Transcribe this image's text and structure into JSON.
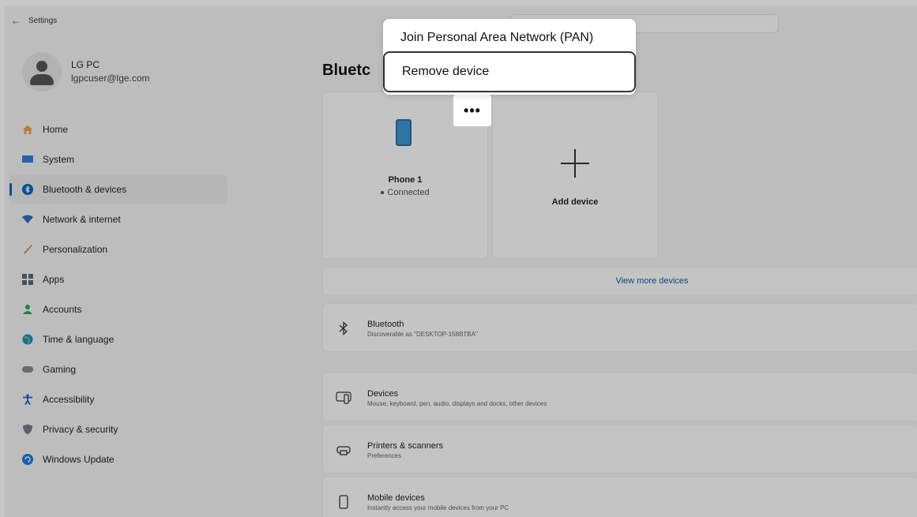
{
  "window": {
    "title": "Settings",
    "back_icon": "←"
  },
  "profile": {
    "name": "LG PC",
    "email": "lgpcuser@lge.com"
  },
  "sidebar": {
    "items": [
      {
        "label": "Home",
        "icon": "home-icon",
        "color": "#e8a33c"
      },
      {
        "label": "System",
        "icon": "system-icon",
        "color": "#2f7fd8"
      },
      {
        "label": "Bluetooth & devices",
        "icon": "bluetooth-icon",
        "color": "#0067c0",
        "active": true
      },
      {
        "label": "Network & internet",
        "icon": "wifi-icon",
        "color": "#2a6cc8"
      },
      {
        "label": "Personalization",
        "icon": "brush-icon",
        "color": "#c98a3a"
      },
      {
        "label": "Apps",
        "icon": "apps-icon",
        "color": "#5a6a7a"
      },
      {
        "label": "Accounts",
        "icon": "accounts-icon",
        "color": "#2aa25a"
      },
      {
        "label": "Time & language",
        "icon": "globe-icon",
        "color": "#1f8ad0"
      },
      {
        "label": "Gaming",
        "icon": "gamepad-icon",
        "color": "#8a8a8a"
      },
      {
        "label": "Accessibility",
        "icon": "accessibility-icon",
        "color": "#1660c0"
      },
      {
        "label": "Privacy & security",
        "icon": "shield-icon",
        "color": "#7a7a8a"
      },
      {
        "label": "Windows Update",
        "icon": "update-icon",
        "color": "#1a7ad8"
      }
    ]
  },
  "main": {
    "title": "Bluetc",
    "device": {
      "name": "Phone 1",
      "status": "Connected"
    },
    "add_device_label": "Add device",
    "view_more": "View more devices",
    "rows": [
      {
        "title": "Bluetooth",
        "subtitle": "Discoverable as \"DESKTOP-158BTBA\""
      },
      {
        "title": "Devices",
        "subtitle": "Mouse, keyboard, pen, audio, displays and docks, other devices"
      },
      {
        "title": "Printers & scanners",
        "subtitle": "Preferences"
      },
      {
        "title": "Mobile devices",
        "subtitle": "Instantly access your mobile devices from your PC"
      }
    ]
  },
  "context_menu": {
    "more_label": "•••",
    "items": [
      {
        "label": "Join Personal Area Network (PAN)"
      },
      {
        "label": "Remove device",
        "highlighted": true
      }
    ]
  }
}
